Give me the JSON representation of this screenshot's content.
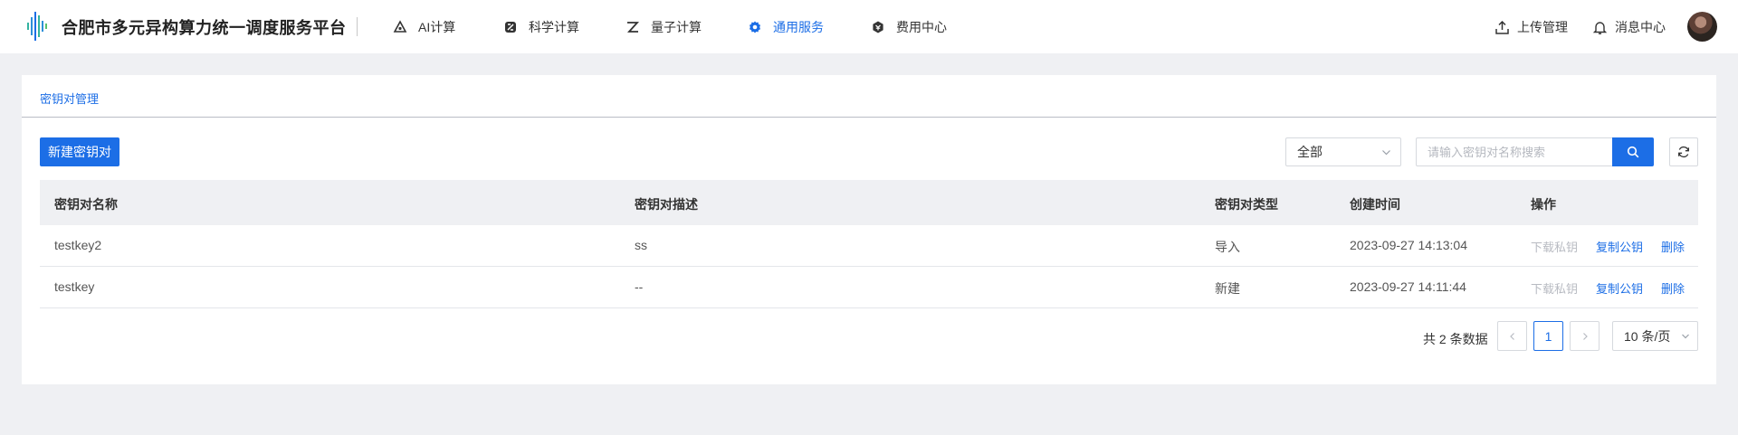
{
  "header": {
    "brand": "合肥市多元异构算力统一调度服务平台",
    "nav": [
      {
        "label": "AI计算",
        "icon": "ai-compute-icon",
        "active": false
      },
      {
        "label": "科学计算",
        "icon": "science-compute-icon",
        "active": false
      },
      {
        "label": "量子计算",
        "icon": "quantum-compute-icon",
        "active": false
      },
      {
        "label": "通用服务",
        "icon": "gear-icon",
        "active": true
      },
      {
        "label": "费用中心",
        "icon": "billing-icon",
        "active": false
      }
    ],
    "upload_label": "上传管理",
    "messages_label": "消息中心",
    "accent_color": "#1c6ee6"
  },
  "page": {
    "title": "密钥对管理",
    "new_button": "新建密钥对",
    "filter_selected": "全部",
    "search_placeholder": "请输入密钥对名称搜索"
  },
  "table": {
    "columns": [
      "密钥对名称",
      "密钥对描述",
      "密钥对类型",
      "创建时间",
      "操作"
    ],
    "rows": [
      {
        "name": "testkey2",
        "description": "ss",
        "type": "导入",
        "created": "2023-09-27 14:13:04",
        "ops": {
          "download": "下载私钥",
          "copy": "复制公钥",
          "delete": "删除"
        }
      },
      {
        "name": "testkey",
        "description": "--",
        "type": "新建",
        "created": "2023-09-27 14:11:44",
        "ops": {
          "download": "下载私钥",
          "copy": "复制公钥",
          "delete": "删除"
        }
      }
    ]
  },
  "pagination": {
    "total_text": "共 2 条数据",
    "current_page": "1",
    "page_size": "10 条/页"
  }
}
